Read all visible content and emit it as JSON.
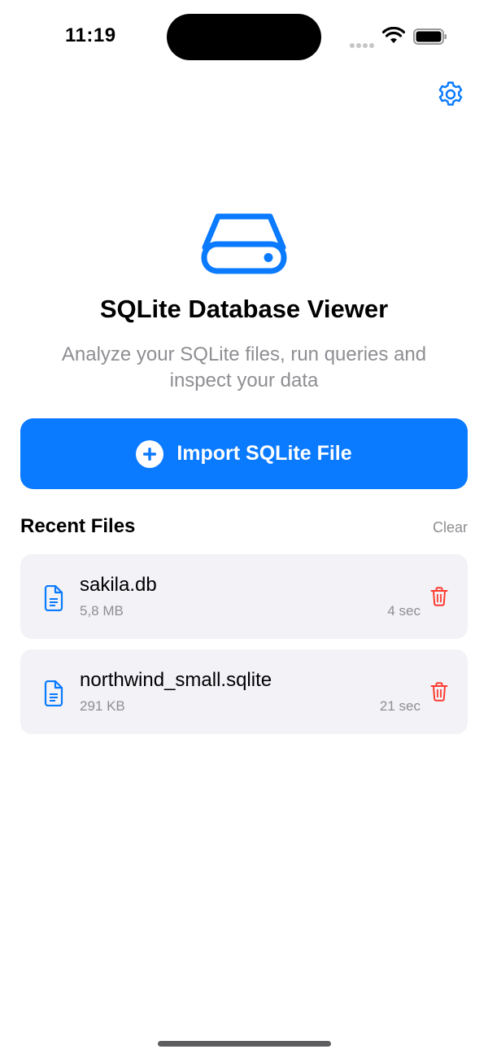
{
  "status_bar": {
    "time": "11:19"
  },
  "header": {
    "settings_icon": "gear-icon"
  },
  "hero": {
    "icon": "database-drive-icon",
    "title": "SQLite Database Viewer",
    "subtitle": "Analyze your SQLite files, run queries and inspect your data"
  },
  "import_button": {
    "icon": "plus-circle-icon",
    "label": "Import SQLite File"
  },
  "recent": {
    "title": "Recent Files",
    "clear_label": "Clear",
    "files": [
      {
        "name": "sakila.db",
        "size": "5,8 MB",
        "time": "4 sec",
        "icon": "document-icon",
        "delete_icon": "trash-icon"
      },
      {
        "name": "northwind_small.sqlite",
        "size": "291 KB",
        "time": "21 sec",
        "icon": "document-icon",
        "delete_icon": "trash-icon"
      }
    ]
  },
  "colors": {
    "accent": "#0a7aff",
    "destructive": "#ff3b30",
    "secondary_text": "#8e8e93",
    "card_background": "#f2f2f7"
  }
}
